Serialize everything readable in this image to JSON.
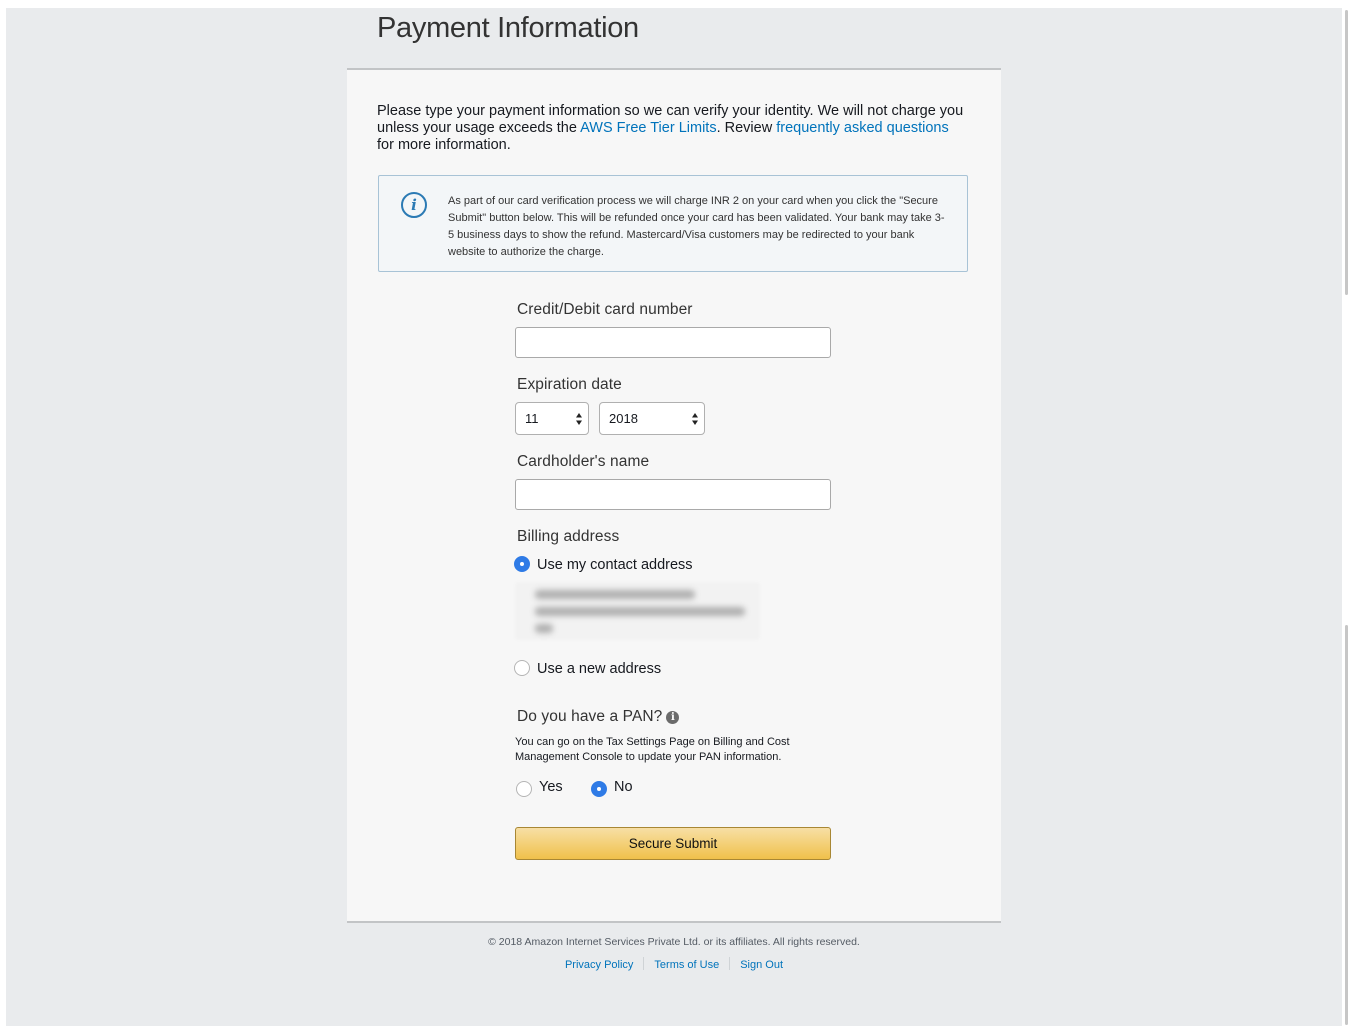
{
  "page": {
    "title": "Payment Information"
  },
  "intro": {
    "text_before": "Please type your payment information so we can verify your identity. We will not charge you unless your usage exceeds the ",
    "free_tier_link": "AWS Free Tier Limits",
    "text_middle": ". Review ",
    "faq_link": "frequently asked questions",
    "text_after": " for more information."
  },
  "notice": {
    "icon": "info-icon",
    "text": "As part of our card verification process we will charge INR 2 on your card when you click the \"Secure Submit\" button below. This will be refunded once your card has been validated. Your bank may take 3-5 business days to show the refund. Mastercard/Visa customers may be redirected to your bank website to authorize the charge."
  },
  "form": {
    "card_number_label": "Credit/Debit card number",
    "card_number_value": "",
    "expiration_label": "Expiration date",
    "expiration_month": "11",
    "expiration_year": "2018",
    "cardholder_label": "Cardholder's name",
    "cardholder_value": "",
    "billing_label": "Billing address",
    "billing_options": [
      {
        "label": "Use my contact address",
        "selected": true
      },
      {
        "label": "Use a new address",
        "selected": false
      }
    ],
    "pan_question": "Do you have a PAN?",
    "pan_help": "You can go on the Tax Settings Page on Billing and Cost Management Console to update your PAN information.",
    "pan_options": [
      {
        "label": "Yes",
        "selected": false
      },
      {
        "label": "No",
        "selected": true
      }
    ],
    "submit_label": "Secure Submit"
  },
  "footer": {
    "copyright": "© 2018 Amazon Internet Services Private Ltd. or its affiliates. All rights reserved.",
    "links": [
      "Privacy Policy",
      "Terms of Use",
      "Sign Out"
    ]
  },
  "colors": {
    "link": "#0073bb",
    "radio_selected": "#2f7be6",
    "submit_button": "#f0c14b",
    "page_background": "#e9ebed"
  }
}
